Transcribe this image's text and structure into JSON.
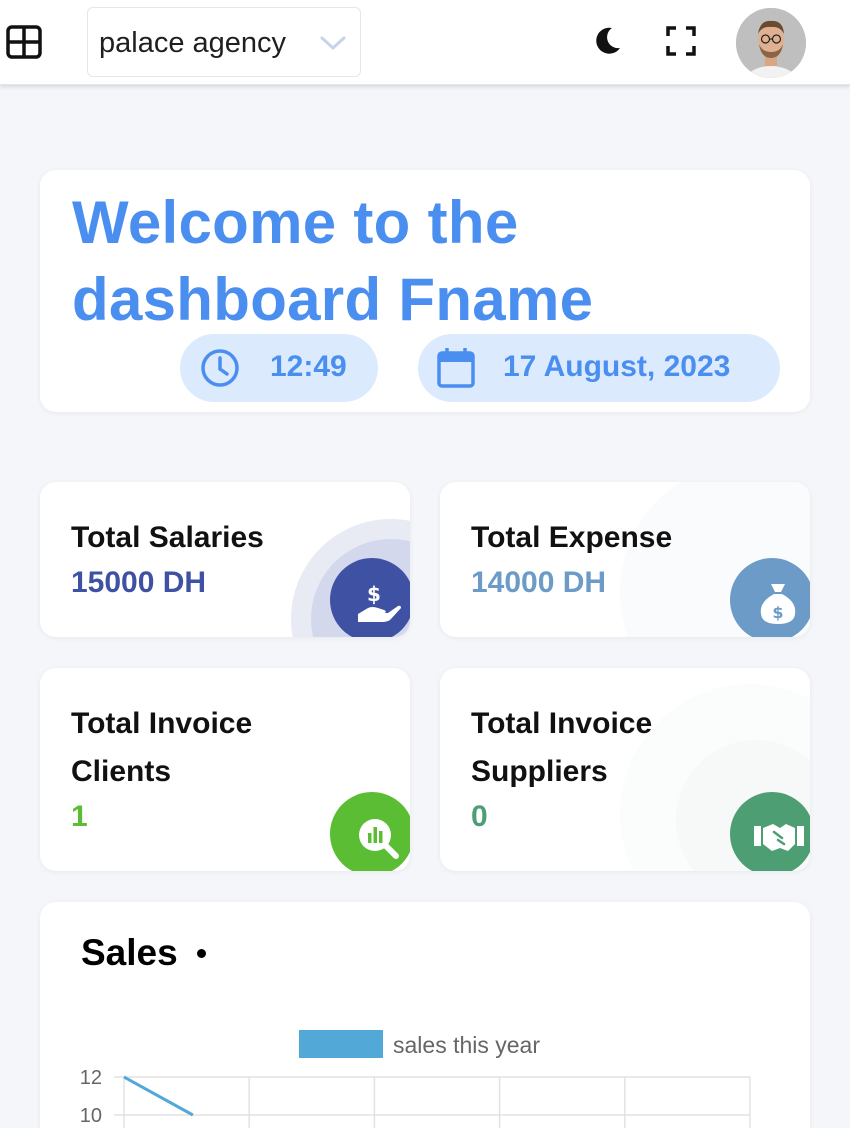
{
  "header": {
    "agency_select": "palace agency",
    "icons": [
      "grid-icon",
      "chevron-down-icon",
      "moon-icon",
      "fullscreen-icon"
    ]
  },
  "welcome": {
    "title": "Welcome to the dashboard Fname",
    "time": "12:49",
    "date": "17 August, 2023",
    "accent_color": "#4a8ef0"
  },
  "stats": [
    {
      "title": "Total Salaries",
      "value": "15000 DH",
      "color": "#3f51a3",
      "icon": "hand-dollar-icon"
    },
    {
      "title": "Total Expense",
      "value": "14000 DH",
      "color": "#6b9bc6",
      "icon": "money-bag-icon"
    },
    {
      "title": "Total Invoice Clients",
      "value": "1",
      "color": "#5bbd34",
      "icon": "chart-search-icon"
    },
    {
      "title": "Total Invoice Suppliers",
      "value": "0",
      "color": "#4e9e74",
      "icon": "handshake-icon"
    }
  ],
  "sales": {
    "title": "Sales"
  },
  "chart_data": {
    "type": "line",
    "series": [
      {
        "name": "sales this year",
        "color": "#52a8d6",
        "points": [
          [
            0,
            12
          ],
          [
            0.55,
            10
          ]
        ]
      }
    ],
    "y_ticks": [
      "12",
      "10"
    ],
    "grid": true,
    "legend": "top"
  }
}
